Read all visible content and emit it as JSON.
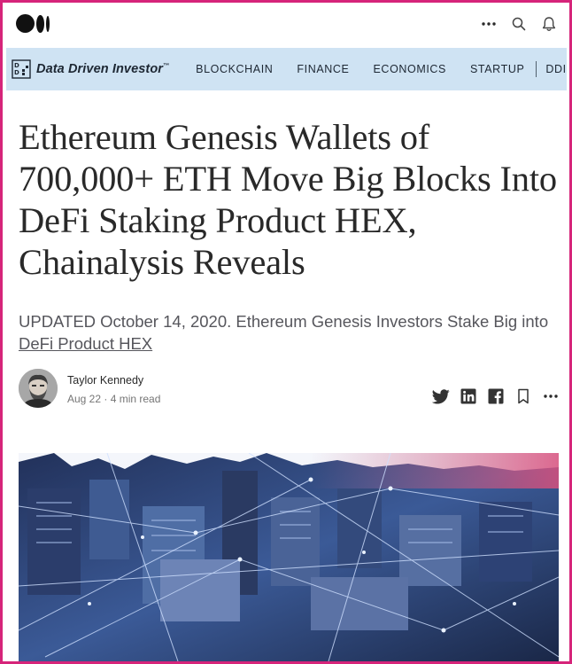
{
  "publication": {
    "name": "Data Driven Investor",
    "trademark": "™",
    "nav": [
      "BLOCKCHAIN",
      "FINANCE",
      "ECONOMICS",
      "STARTUP"
    ],
    "nav_extra": "DDI"
  },
  "article": {
    "title": "Ethereum Genesis Wallets of 700,000+ ETH Move Big Blocks Into DeFi Staking Product HEX, Chainalysis Reveals",
    "subtitle_text": "UPDATED October 14, 2020. Ethereum Genesis Investors Stake Big into ",
    "subtitle_link": "DeFi Product HEX"
  },
  "author": {
    "name": "Taylor Kennedy",
    "meta": "Aug 22 · 4 min read"
  },
  "icons": {
    "top": [
      "more-icon",
      "search-icon",
      "bell-icon"
    ],
    "share": [
      "twitter-icon",
      "linkedin-icon",
      "facebook-icon",
      "bookmark-icon",
      "more-icon"
    ]
  },
  "colors": {
    "frame": "#d6247a",
    "pub_bar": "#cfe3f3",
    "text": "#292929",
    "muted": "#757575"
  }
}
